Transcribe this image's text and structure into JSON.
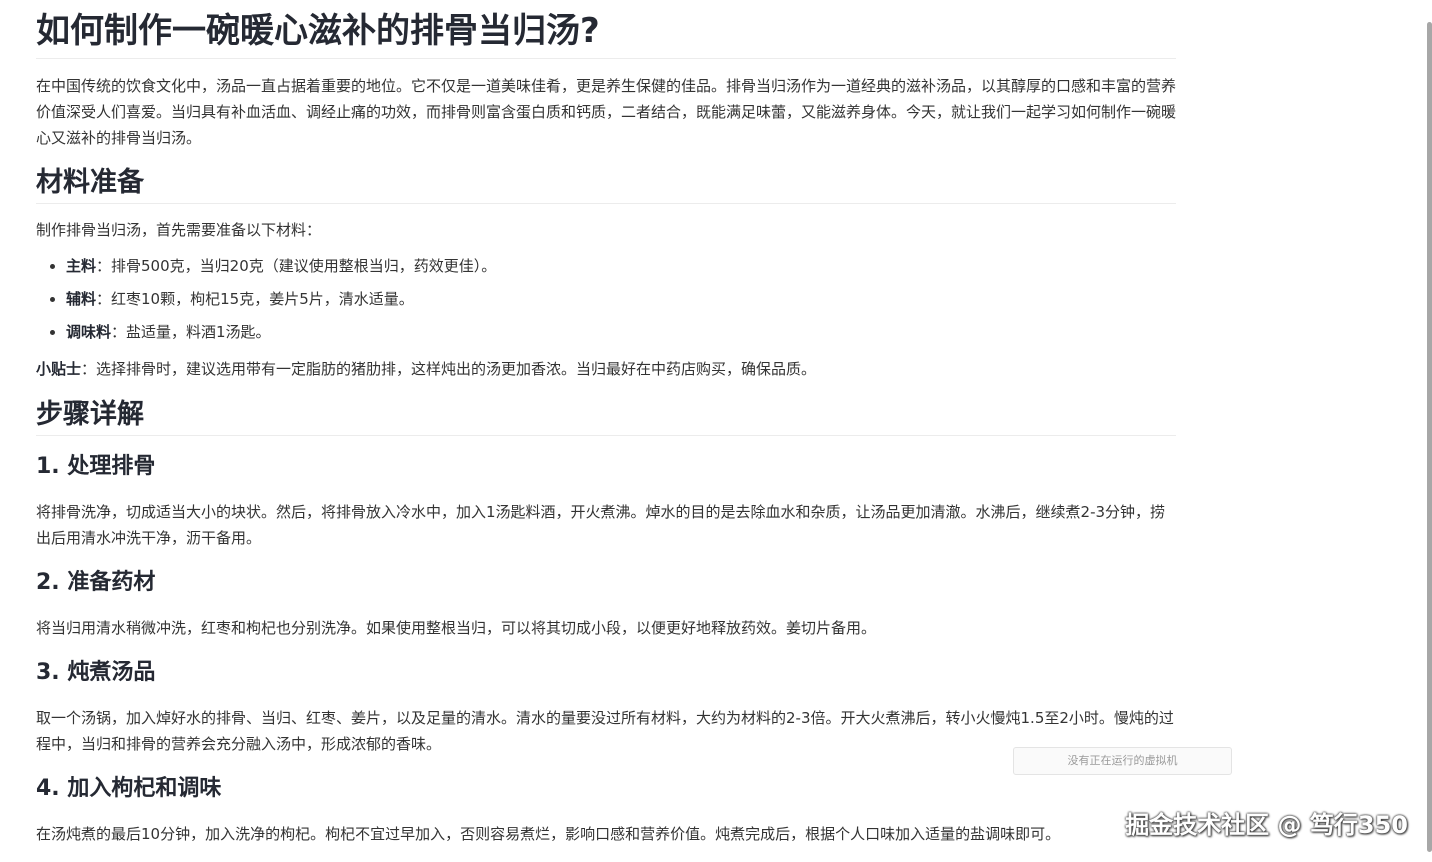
{
  "article": {
    "title": "如何制作一碗暖心滋补的排骨当归汤?",
    "intro": "在中国传统的饮食文化中，汤品一直占据着重要的地位。它不仅是一道美味佳肴，更是养生保健的佳品。排骨当归汤作为一道经典的滋补汤品，以其醇厚的口感和丰富的营养价值深受人们喜爱。当归具有补血活血、调经止痛的功效，而排骨则富含蛋白质和钙质，二者结合，既能满足味蕾，又能滋养身体。今天，就让我们一起学习如何制作一碗暖心又滋补的排骨当归汤。",
    "materials": {
      "heading": "材料准备",
      "lead": "制作排骨当归汤，首先需要准备以下材料：",
      "items": [
        {
          "label": "主料",
          "text": "：排骨500克，当归20克（建议使用整根当归，药效更佳）。"
        },
        {
          "label": "辅料",
          "text": "：红枣10颗，枸杞15克，姜片5片，清水适量。"
        },
        {
          "label": "调味料",
          "text": "：盐适量，料酒1汤匙。"
        }
      ],
      "tip_label": "小贴士",
      "tip_text": "：选择排骨时，建议选用带有一定脂肪的猪肋排，这样炖出的汤更加香浓。当归最好在中药店购买，确保品质。"
    },
    "steps": {
      "heading": "步骤详解",
      "items": [
        {
          "title": "1. 处理排骨",
          "text": "将排骨洗净，切成适当大小的块状。然后，将排骨放入冷水中，加入1汤匙料酒，开火煮沸。焯水的目的是去除血水和杂质，让汤品更加清澈。水沸后，继续煮2-3分钟，捞出后用清水冲洗干净，沥干备用。"
        },
        {
          "title": "2. 准备药材",
          "text": "将当归用清水稍微冲洗，红枣和枸杞也分别洗净。如果使用整根当归，可以将其切成小段，以便更好地释放药效。姜切片备用。"
        },
        {
          "title": "3. 炖煮汤品",
          "text": "取一个汤锅，加入焯好水的排骨、当归、红枣、姜片，以及足量的清水。清水的量要没过所有材料，大约为材料的2-3倍。开大火煮沸后，转小火慢炖1.5至2小时。慢炖的过程中，当归和排骨的营养会充分融入汤中，形成浓郁的香味。"
        },
        {
          "title": "4. 加入枸杞和调味",
          "text": "在汤炖煮的最后10分钟，加入洗净的枸杞。枸杞不宜过早加入，否则容易煮烂，影响口感和营养价值。炖煮完成后，根据个人口味加入适量的盐调味即可。"
        }
      ]
    }
  },
  "overlay": {
    "vm_status": "没有正在运行的虚拟机",
    "watermark": "掘金技术社区 @ 笃行350"
  }
}
